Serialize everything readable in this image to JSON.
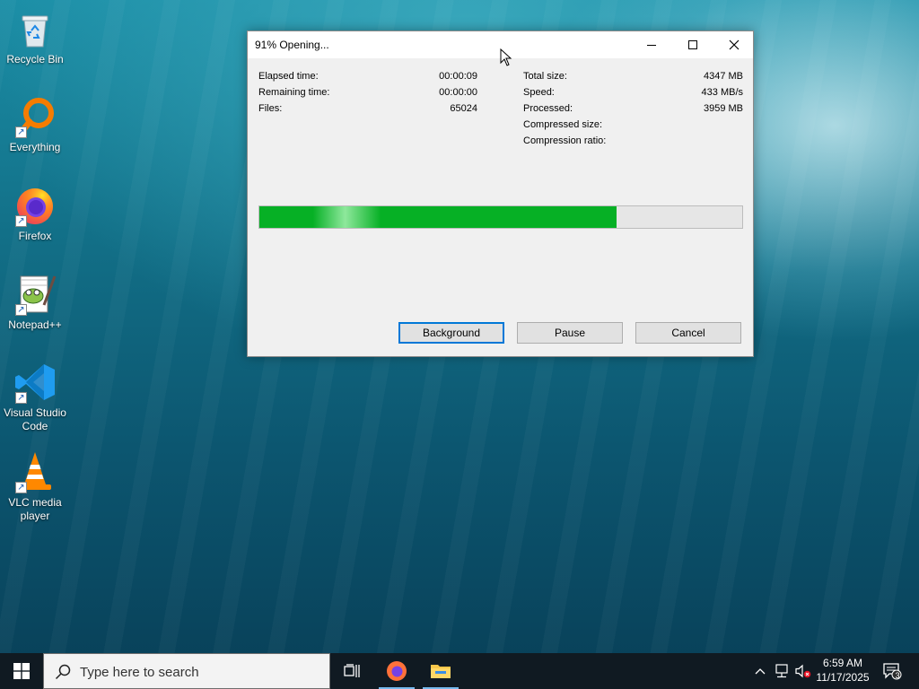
{
  "desktop": {
    "icons": [
      {
        "label": "Recycle Bin"
      },
      {
        "label": "Everything"
      },
      {
        "label": "Firefox"
      },
      {
        "label": "Notepad++"
      },
      {
        "label": "Visual Studio Code"
      },
      {
        "label": "VLC media player"
      }
    ]
  },
  "dialog": {
    "title": "91% Opening...",
    "left": [
      {
        "label": "Elapsed time:",
        "value": "00:00:09"
      },
      {
        "label": "Remaining time:",
        "value": "00:00:00"
      },
      {
        "label": "Files:",
        "value": "65024"
      }
    ],
    "right": [
      {
        "label": "Total size:",
        "value": "4347 MB"
      },
      {
        "label": "Speed:",
        "value": "433 MB/s"
      },
      {
        "label": "Processed:",
        "value": "3959 MB"
      },
      {
        "label": "Compressed size:",
        "value": ""
      },
      {
        "label": "Compression ratio:",
        "value": ""
      }
    ],
    "progress_percent": 74,
    "buttons": {
      "background": "Background",
      "pause": "Pause",
      "cancel": "Cancel"
    },
    "accent": "#06b025"
  },
  "taskbar": {
    "search_placeholder": "Type here to search",
    "time": "6:59 AM",
    "date": "11/17/2025",
    "notification_count": "3",
    "icons": [
      "windows-start-icon",
      "search-icon",
      "task-view-icon",
      "firefox-icon",
      "file-explorer-icon",
      "chevron-up-icon",
      "network-icon",
      "volume-muted-icon",
      "notification-icon"
    ]
  }
}
